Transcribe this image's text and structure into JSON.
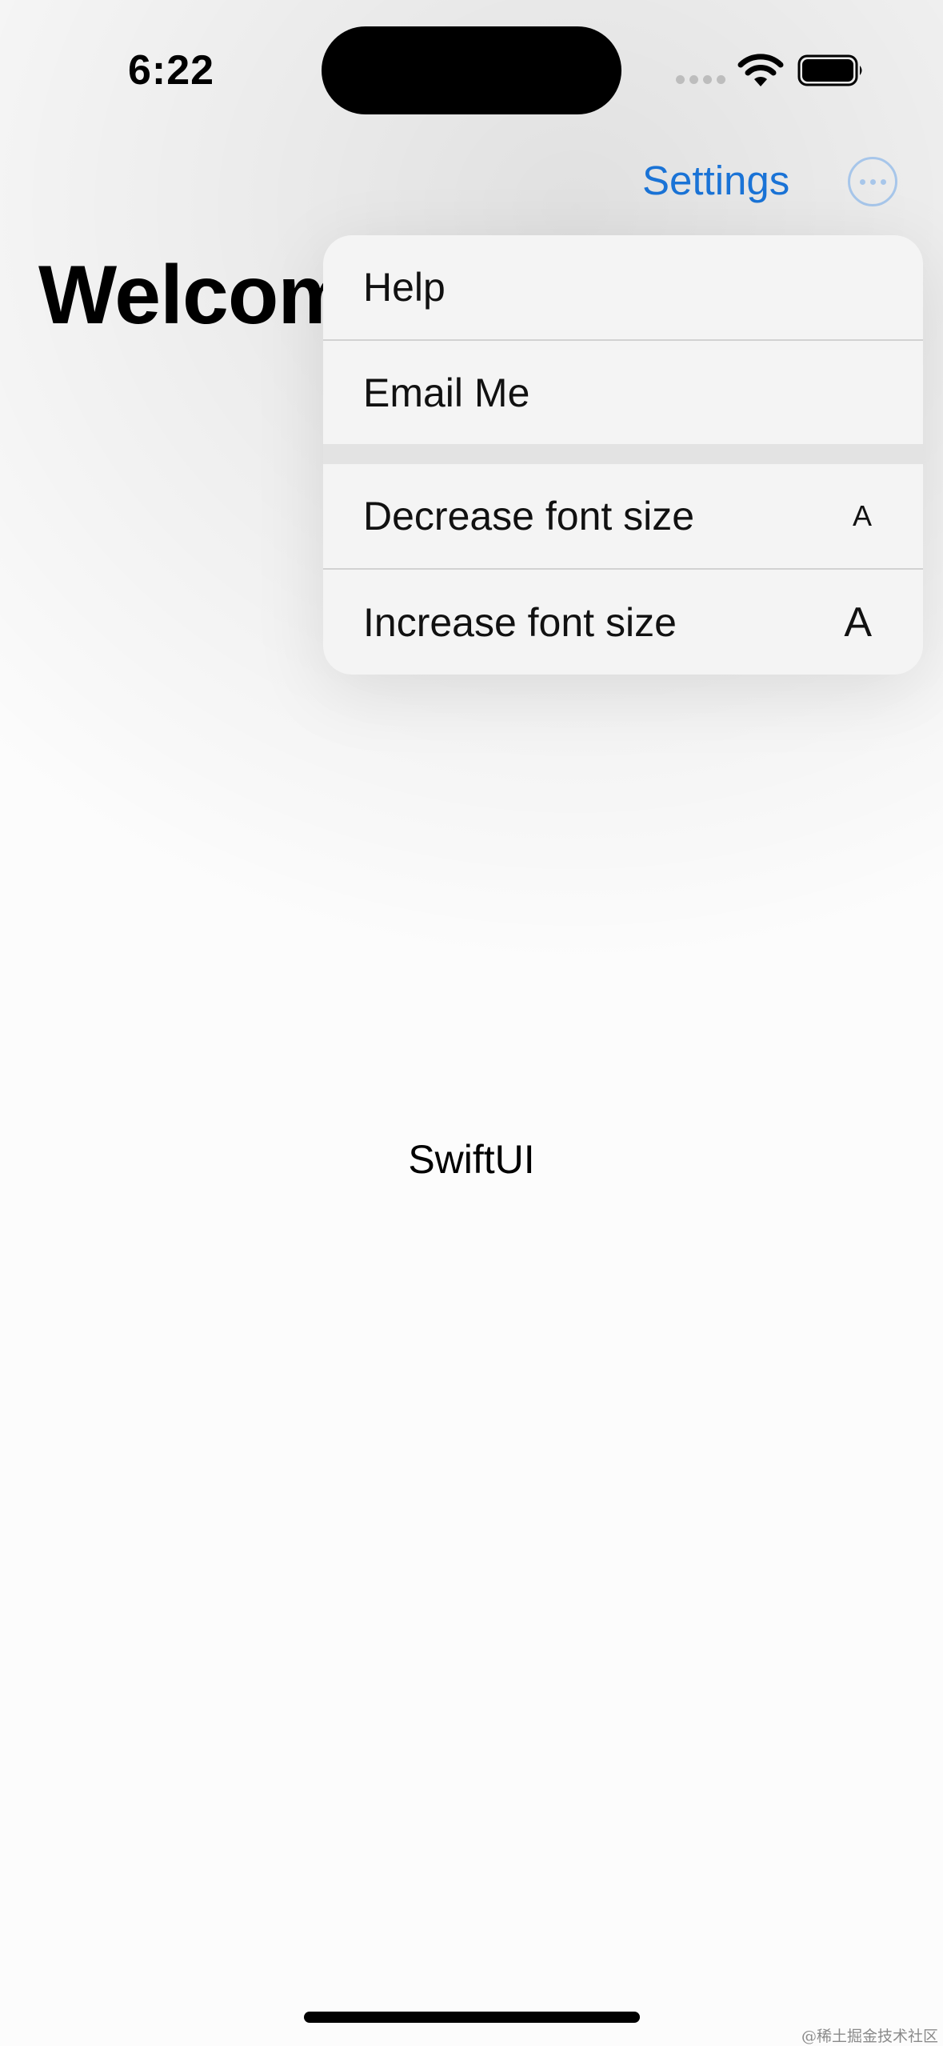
{
  "status_bar": {
    "time": "6:22",
    "icons": [
      "cellular-signal-icon",
      "wifi-icon",
      "battery-icon"
    ]
  },
  "nav": {
    "settings_label": "Settings",
    "more_icon": "ellipsis-circle-icon",
    "accent_color": "#1a73d6"
  },
  "page": {
    "title": "Welcom",
    "center_text": "SwiftUI"
  },
  "menu": {
    "items": [
      {
        "label": "Help"
      },
      {
        "label": "Email Me"
      },
      {
        "label": "Decrease font size",
        "symbol": "A"
      },
      {
        "label": "Increase font size",
        "symbol": "A"
      }
    ]
  },
  "watermark": "@稀土掘金技术社区"
}
